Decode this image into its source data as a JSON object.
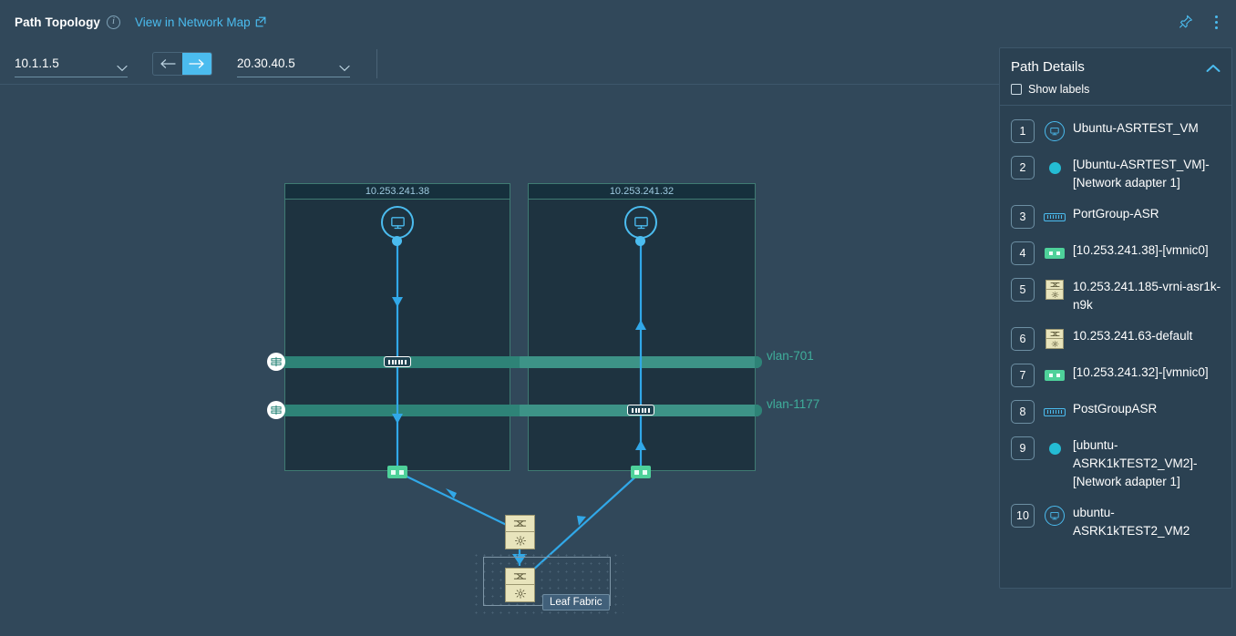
{
  "header": {
    "title": "Path Topology",
    "info_icon": "info-icon",
    "view_link": "View in Network Map",
    "external_link_icon": "external-link-icon",
    "pin_icon": "pin-icon",
    "more_icon": "kebab-menu-icon"
  },
  "toolbar": {
    "source": {
      "value": "10.1.1.5",
      "caret_icon": "chevron-down-icon"
    },
    "destination": {
      "value": "20.30.40.5",
      "caret_icon": "chevron-down-icon"
    },
    "direction": {
      "reverse_icon": "arrow-left-icon",
      "forward_icon": "arrow-right-icon",
      "selected": "forward"
    }
  },
  "topology": {
    "hosts": [
      {
        "label": "10.253.241.38"
      },
      {
        "label": "10.253.241.32"
      }
    ],
    "vlans": [
      {
        "label": "vlan-701",
        "icon": "network-switch-icon"
      },
      {
        "label": "vlan-1177",
        "icon": "network-switch-icon"
      }
    ],
    "fabric": {
      "label": "Leaf Fabric"
    },
    "icons": {
      "vm": "desktop-vm-icon",
      "portgroup": "port-group-icon",
      "vmnic": "vmnic-icon",
      "switch": "switch-icon",
      "router": "router-icon"
    }
  },
  "panel": {
    "title": "Path Details",
    "collapse_icon": "chevron-up-icon",
    "show_labels": {
      "label": "Show labels",
      "checked": false
    },
    "hops": [
      {
        "num": "1",
        "icon": "vm",
        "label": "Ubuntu-ASRTEST_VM"
      },
      {
        "num": "2",
        "icon": "dot",
        "label": "[Ubuntu-ASRTEST_VM]-[Network adapter 1]"
      },
      {
        "num": "3",
        "icon": "pg",
        "label": "PortGroup-ASR"
      },
      {
        "num": "4",
        "icon": "nic",
        "label": "[10.253.241.38]-[vmnic0]"
      },
      {
        "num": "5",
        "icon": "device",
        "label": "10.253.241.185-vrni-asr1k-n9k"
      },
      {
        "num": "6",
        "icon": "device",
        "label": "10.253.241.63-default"
      },
      {
        "num": "7",
        "icon": "nic",
        "label": "[10.253.241.32]-[vmnic0]"
      },
      {
        "num": "8",
        "icon": "pg",
        "label": "PostGroupASR"
      },
      {
        "num": "9",
        "icon": "dot",
        "label": "[ubuntu-ASRK1kTEST2_VM2]-[Network adapter 1]"
      },
      {
        "num": "10",
        "icon": "vm",
        "label": "ubuntu-ASRK1kTEST2_VM2"
      }
    ]
  },
  "colors": {
    "background": "#31485a",
    "panel": "#2b4152",
    "accent": "#4bbcef",
    "vlan": "#2e8377",
    "vlan_text": "#3fae9b",
    "nic_green": "#4ed19a",
    "device_tan": "#e8e4bc",
    "host_fill": "#1e3340"
  }
}
